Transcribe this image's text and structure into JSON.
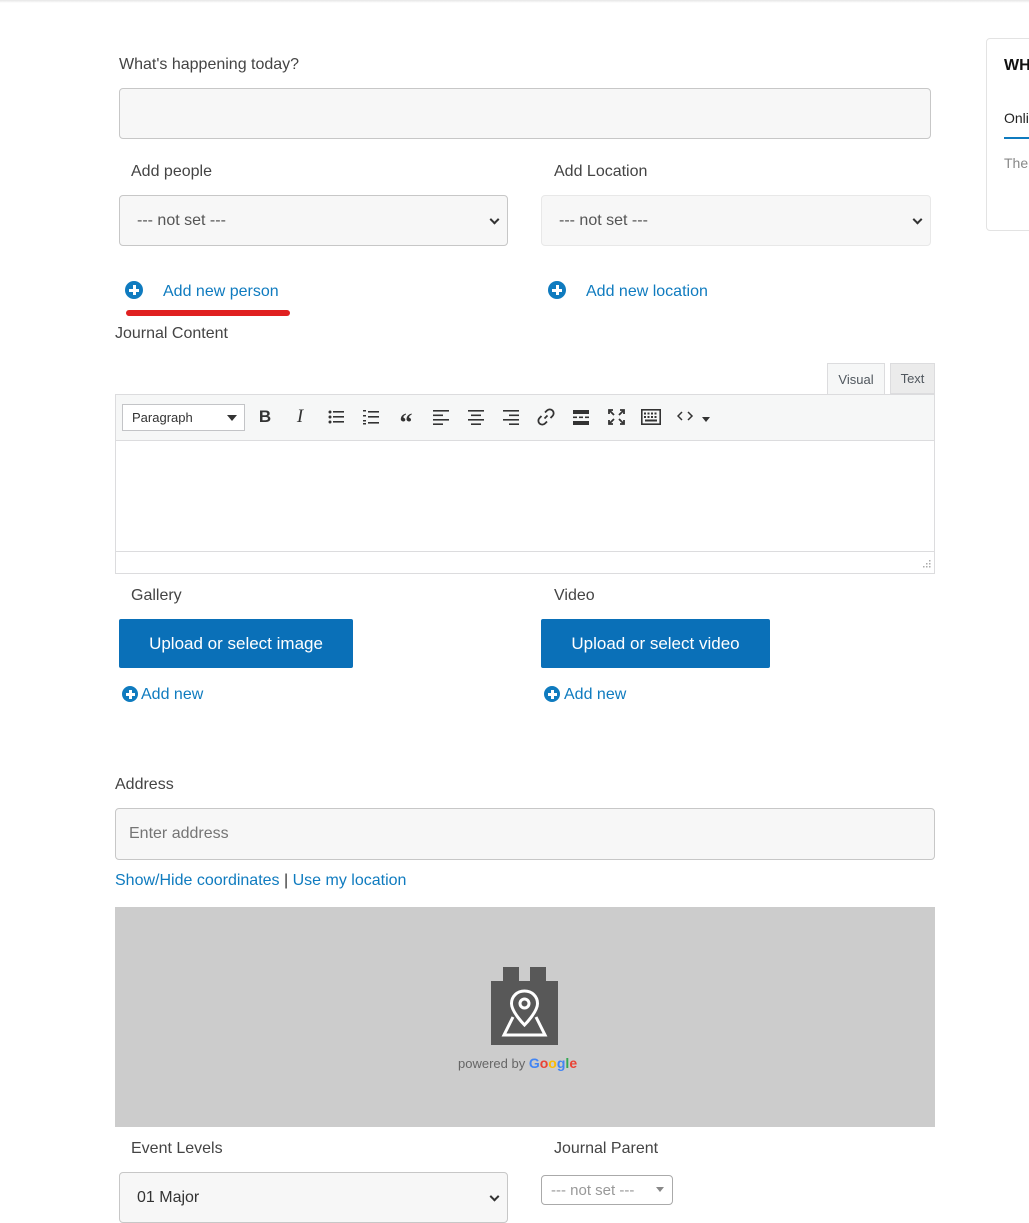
{
  "form": {
    "happening_label": "What's happening today?",
    "happening_value": "",
    "add_people_label": "Add people",
    "add_people_value": "--- not set ---",
    "add_location_label": "Add Location",
    "add_location_value": "--- not set ---",
    "add_new_person": "Add new person",
    "add_new_location": "Add new location",
    "journal_content_label": "Journal Content"
  },
  "editor": {
    "tab_visual": "Visual",
    "tab_text": "Text",
    "format_value": "Paragraph",
    "toolbar": [
      "bold-icon",
      "italic-icon",
      "bullet-list-icon",
      "numbered-list-icon",
      "blockquote-icon",
      "align-left-icon",
      "align-center-icon",
      "align-right-icon",
      "link-icon",
      "read-more-icon",
      "fullscreen-icon",
      "keyboard-icon",
      "code-icon"
    ]
  },
  "media": {
    "gallery_label": "Gallery",
    "upload_image": "Upload or select image",
    "gallery_add_new": "Add new",
    "video_label": "Video",
    "upload_video": "Upload or select video",
    "video_add_new": "Add new"
  },
  "address": {
    "label": "Address",
    "placeholder": "Enter address",
    "show_hide": "Show/Hide coordinates",
    "separator": "|",
    "use_location": "Use my location",
    "map_powered": "powered by",
    "google_letters": [
      "G",
      "o",
      "o",
      "g",
      "l",
      "e"
    ],
    "google_colors": [
      "#4285F4",
      "#EA4335",
      "#FBBC05",
      "#4285F4",
      "#34A853",
      "#EA4335"
    ]
  },
  "bottom": {
    "event_levels_label": "Event Levels",
    "event_levels_value": "01 Major",
    "journal_parent_label": "Journal Parent",
    "journal_parent_value": "--- not set ---"
  },
  "sidebar": {
    "title": "WH",
    "tab": "Onli",
    "text": "The"
  },
  "colors": {
    "link": "#0f7bbf",
    "button": "#0a70b8",
    "annotation": "#e02020",
    "map_bg": "#cccccc"
  }
}
